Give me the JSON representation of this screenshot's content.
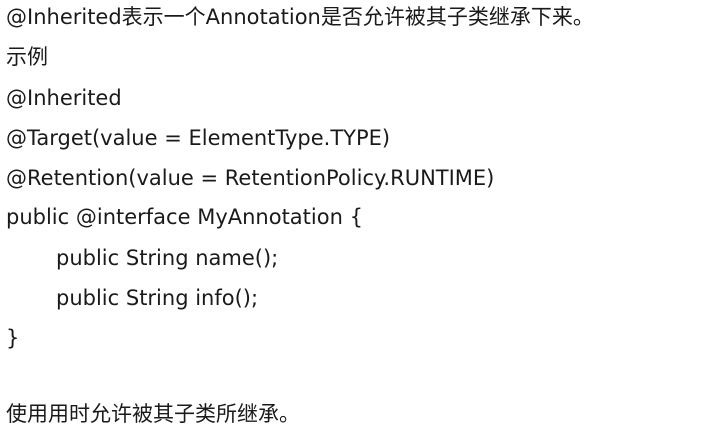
{
  "document": {
    "heading": "@Inherited表示一个Annotation是否允许被其子类继承下来。",
    "example_label": "示例",
    "code_lines": [
      "@Inherited",
      "@Target(value = ElementType.TYPE)",
      "@Retention(value = RetentionPolicy.RUNTIME)",
      "public @interface MyAnnotation {",
      "public String name();",
      "public String info();",
      "}"
    ],
    "conclusion": "使用用时允许被其子类所继承。"
  }
}
